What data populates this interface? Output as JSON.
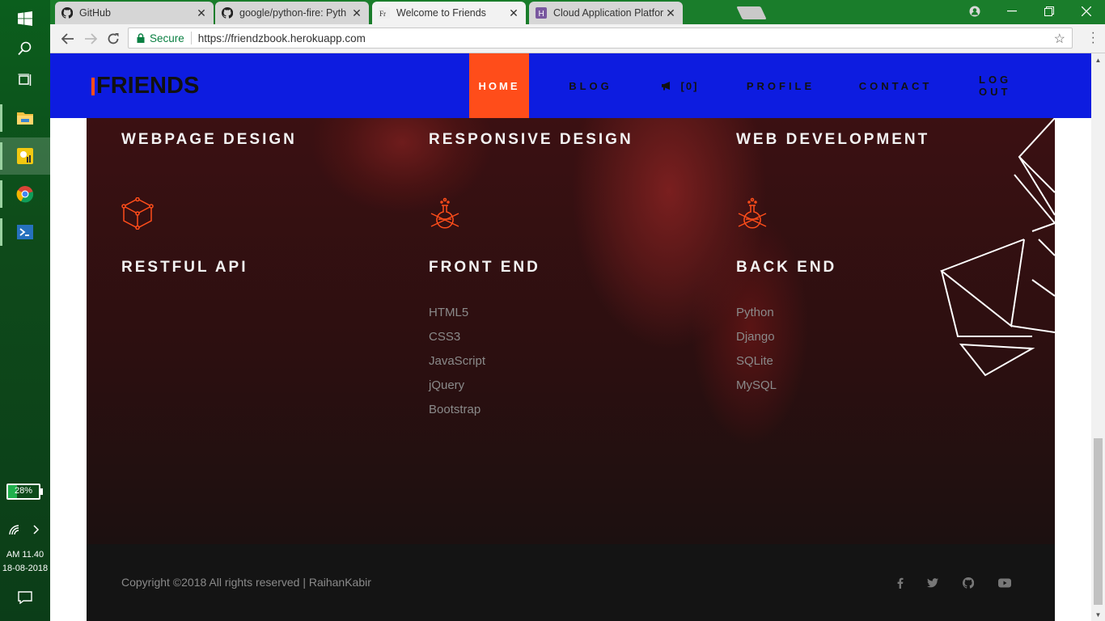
{
  "browser": {
    "tabs": [
      {
        "title": "GitHub",
        "icon": "github-icon"
      },
      {
        "title": "google/python-fire: Pyth",
        "icon": "github-icon"
      },
      {
        "title": "Welcome to Friends",
        "icon": "friends-favicon"
      },
      {
        "title": "Cloud Application Platfor",
        "icon": "heroku-icon"
      }
    ],
    "secure_label": "Secure",
    "url": "https://friendzbook.herokuapp.com"
  },
  "site": {
    "logo": "FRIENDS",
    "nav": [
      "HOME",
      "BLOG",
      "[0]",
      "PROFILE",
      "CONTACT",
      "LOG OUT"
    ],
    "services_top": [
      "WEBPAGE DESIGN",
      "RESPONSIVE DESIGN",
      "WEB DEVELOPMENT"
    ],
    "services_bottom": [
      "RESTFUL API",
      "FRONT END",
      "BACK END"
    ],
    "front_end": [
      "HTML5",
      "CSS3",
      "JavaScript",
      "jQuery",
      "Bootstrap"
    ],
    "back_end": [
      "Python",
      "Django",
      "SQLite",
      "MySQL"
    ],
    "copyright": "Copyright ©2018 All rights reserved | RaihanKabir",
    "social_icons": [
      "facebook-icon",
      "twitter-icon",
      "github-icon",
      "youtube-icon"
    ],
    "accent": "#ff4d1a",
    "nav_bg": "#0d1ce0"
  },
  "taskbar": {
    "battery": "28%",
    "battery_level": 0.28,
    "time": "AM 11.40",
    "date": "18-08-2018"
  }
}
